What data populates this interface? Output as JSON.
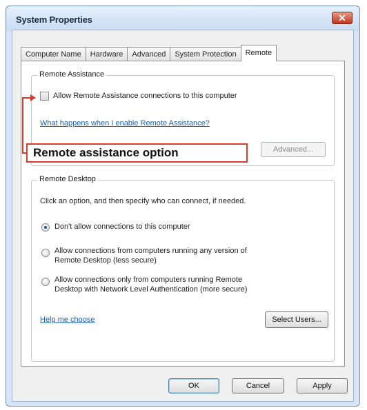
{
  "window": {
    "title": "System Properties",
    "close_glyph": "✕"
  },
  "tabs": [
    {
      "label": "Computer Name"
    },
    {
      "label": "Hardware"
    },
    {
      "label": "Advanced"
    },
    {
      "label": "System Protection"
    },
    {
      "label": "Remote"
    }
  ],
  "active_tab": "Remote",
  "remote_assistance": {
    "group_label": "Remote Assistance",
    "checkbox_label": "Allow Remote Assistance connections to this computer",
    "checkbox_checked": false,
    "link": "What happens when I enable Remote Assistance?",
    "advanced_button": "Advanced..."
  },
  "remote_desktop": {
    "group_label": "Remote Desktop",
    "instructions": "Click an option, and then specify who can connect, if needed.",
    "options": [
      {
        "line1": "Don't allow connections to this computer",
        "line2": "",
        "selected": true
      },
      {
        "line1": "Allow connections from computers running any version of",
        "line2": "Remote Desktop (less secure)",
        "selected": false
      },
      {
        "line1": "Allow connections only from computers running Remote",
        "line2": "Desktop with Network Level Authentication (more secure)",
        "selected": false
      }
    ],
    "help_link": "Help me choose",
    "select_users_button": "Select Users..."
  },
  "footer": {
    "ok": "OK",
    "cancel": "Cancel",
    "apply": "Apply"
  },
  "annotation": {
    "callout_text": "Remote assistance option",
    "color": "#e23a2b"
  },
  "colors": {
    "link": "#1a5fb4",
    "window_frame": "#d7e6f6",
    "close_button": "#c2351c"
  }
}
